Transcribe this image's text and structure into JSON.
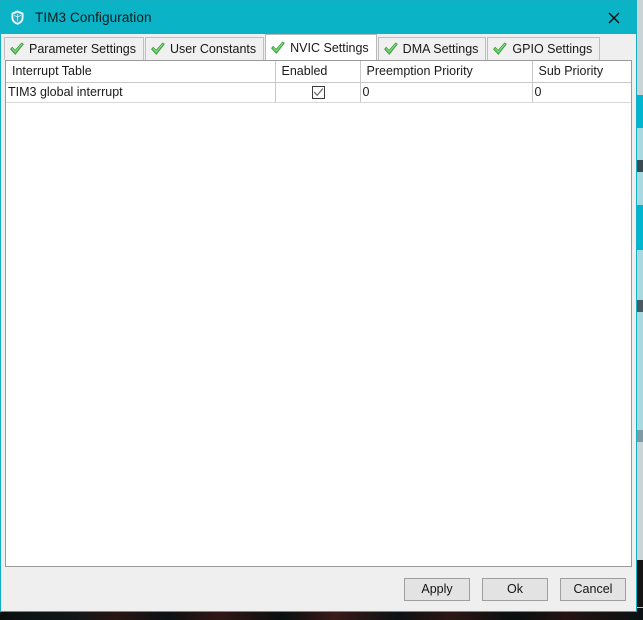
{
  "window": {
    "title": "TIM3 Configuration",
    "icon": "shield-icon",
    "close_label": "✕",
    "accent_color": "#0bb3c7"
  },
  "tabs": [
    {
      "label": "Parameter Settings",
      "icon": "green-check-icon",
      "active": false
    },
    {
      "label": "User Constants",
      "icon": "green-check-icon",
      "active": false
    },
    {
      "label": "NVIC Settings",
      "icon": "green-check-icon",
      "active": true
    },
    {
      "label": "DMA Settings",
      "icon": "green-check-icon",
      "active": false
    },
    {
      "label": "GPIO Settings",
      "icon": "green-check-icon",
      "active": false
    }
  ],
  "table": {
    "columns": [
      "Interrupt Table",
      "Enabled",
      "Preemption Priority",
      "Sub Priority"
    ],
    "rows": [
      {
        "name": "TIM3 global interrupt",
        "enabled": true,
        "preemption_priority": "0",
        "sub_priority": "0"
      }
    ]
  },
  "buttons": {
    "apply": "Apply",
    "ok": "Ok",
    "cancel": "Cancel"
  }
}
